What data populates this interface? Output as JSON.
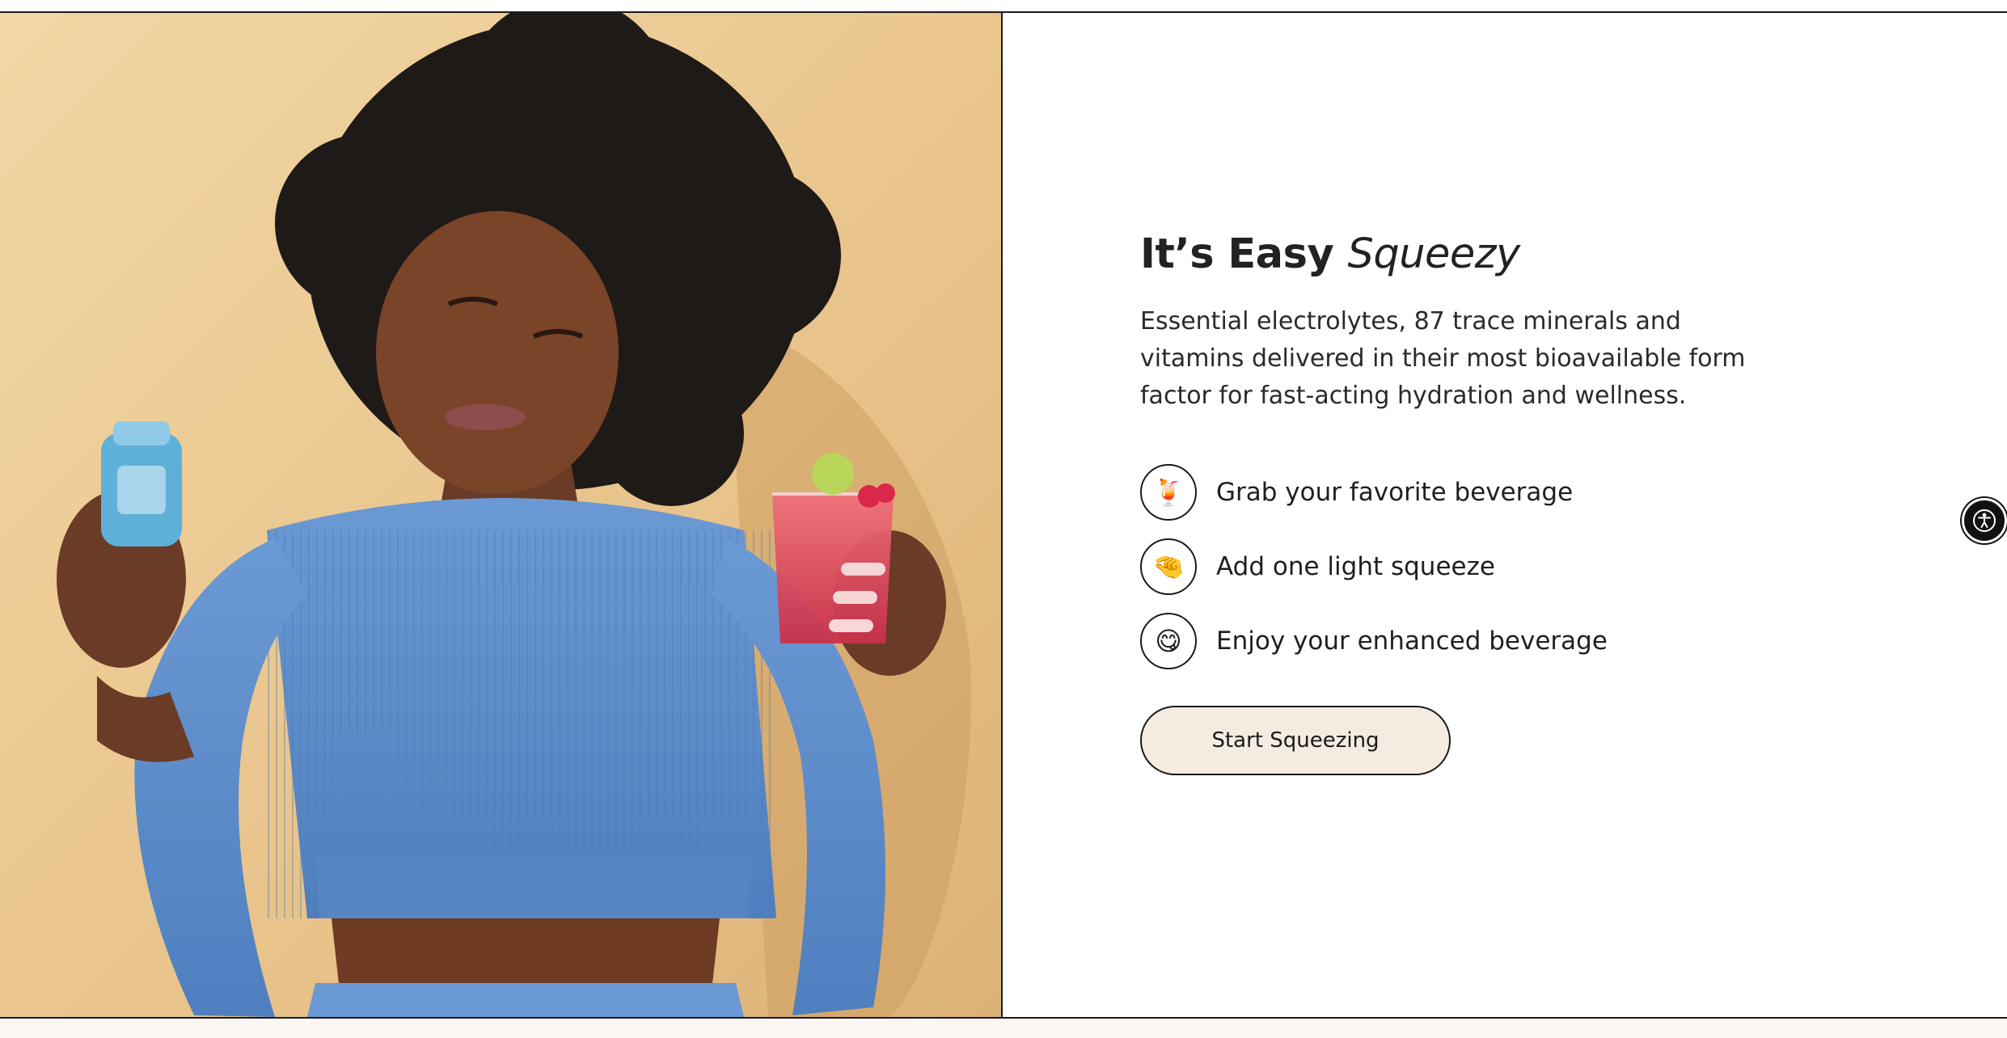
{
  "hero": {
    "image_alt": "Woman in a blue top holding a water enhancer bottle and a red drink"
  },
  "section": {
    "title_regular": "It’s Easy",
    "title_italic": "Squeezy",
    "description": "Essential electrolytes, 87 trace minerals and vitamins delivered in their most bioavailable form factor for fast-acting hydration and wellness."
  },
  "steps": [
    {
      "icon": "tropical-drink-icon",
      "emoji": "🍹",
      "label": "Grab your favorite beverage"
    },
    {
      "icon": "pinching-hand-icon",
      "emoji": "🤏",
      "label": "Add one light squeeze"
    },
    {
      "icon": "yum-face-icon",
      "emoji": "😋",
      "label": "Enjoy your enhanced beverage"
    }
  ],
  "cta": {
    "label": "Start Squeezing"
  },
  "accessibility": {
    "icon": "accessibility-icon"
  },
  "colors": {
    "cta_background": "#f4ebe1",
    "hero_background": "#e9c48a",
    "shirt_blue": "#5f8fcd",
    "border": "#1a1a1a"
  }
}
